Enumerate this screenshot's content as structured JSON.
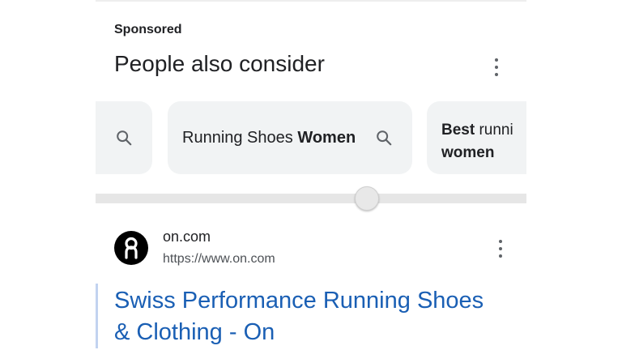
{
  "sponsored_label": "Sponsored",
  "people_also_consider": {
    "title": "People also consider",
    "chips": [
      {
        "text_plain": "Running Shoes ",
        "text_bold": "Women"
      },
      {
        "text_bold": "Best",
        "text_plain": " runni",
        "text_line2": "women"
      }
    ]
  },
  "result": {
    "site_name": "on.com",
    "url": "https://www.on.com",
    "title": "Swiss Performance Running Shoes & Clothing - On"
  },
  "colors": {
    "link": "#1a5fb4",
    "chip_bg": "#f1f3f4",
    "text": "#202124",
    "secondary_text": "#4d5156"
  },
  "icons": [
    "search-icon",
    "more-vert-icon",
    "on-logo"
  ]
}
